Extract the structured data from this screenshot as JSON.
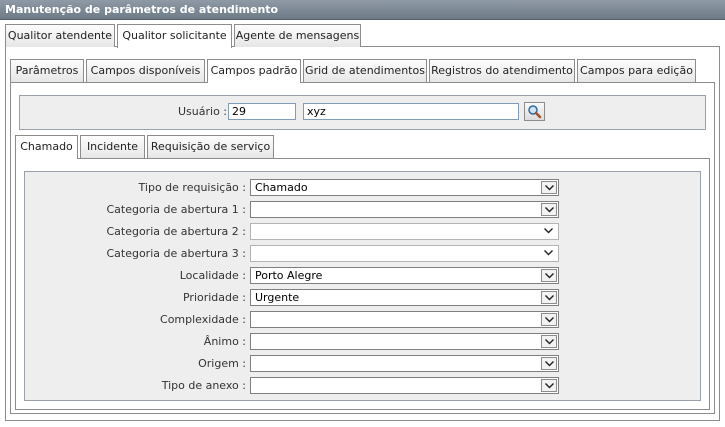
{
  "window": {
    "title": "Manutenção de parâmetros de atendimento"
  },
  "main_tabs": [
    {
      "label": "Qualitor atendente"
    },
    {
      "label": "Qualitor solicitante"
    },
    {
      "label": "Agente de mensagens"
    }
  ],
  "sub_tabs": [
    {
      "label": "Parâmetros"
    },
    {
      "label": "Campos disponíveis"
    },
    {
      "label": "Campos padrão"
    },
    {
      "label": "Grid de atendimentos"
    },
    {
      "label": "Registros do atendimento"
    },
    {
      "label": "Campos para edição"
    }
  ],
  "user": {
    "label": "Usuário :",
    "code": "29",
    "name": "xyz"
  },
  "type_tabs": [
    {
      "label": "Chamado"
    },
    {
      "label": "Incidente"
    },
    {
      "label": "Requisição de serviço"
    }
  ],
  "fields": [
    {
      "label": "Tipo de requisição :",
      "value": "Chamado"
    },
    {
      "label": "Categoria de abertura 1 :",
      "value": ""
    },
    {
      "label": "Categoria de abertura 2 :",
      "value": ""
    },
    {
      "label": "Categoria de abertura 3 :",
      "value": ""
    },
    {
      "label": "Localidade :",
      "value": "Porto Alegre"
    },
    {
      "label": "Prioridade :",
      "value": "Urgente"
    },
    {
      "label": "Complexidade :",
      "value": ""
    },
    {
      "label": "Ânimo :",
      "value": ""
    },
    {
      "label": "Origem :",
      "value": ""
    },
    {
      "label": "Tipo de anexo :",
      "value": ""
    }
  ]
}
